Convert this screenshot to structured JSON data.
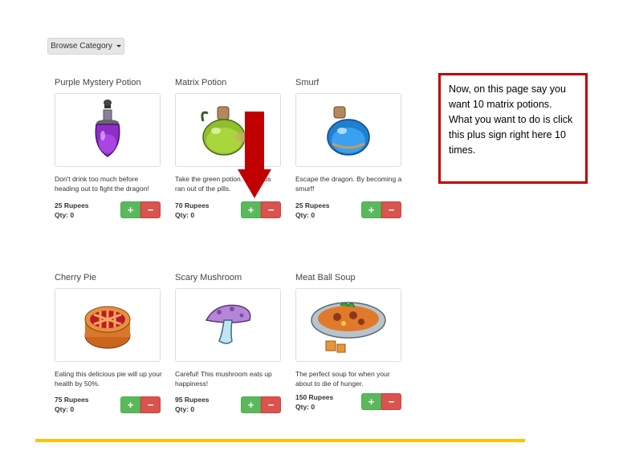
{
  "toolbar": {
    "browse_label": "Browse Category"
  },
  "products": [
    {
      "name": "Purple Mystery Potion",
      "desc": "Don't drink too much before heading out to fight the dragon!",
      "price": "25 Rupees",
      "qty": "Qty: 0",
      "icon": "purple-potion-icon"
    },
    {
      "name": "Matrix Potion",
      "desc": "Take the green potion. Your bus ran out of the pills.",
      "price": "70 Rupees",
      "qty": "Qty: 0",
      "icon": "green-potion-icon"
    },
    {
      "name": "Smurf",
      "desc": "Escape the dragon. By becoming a smurf!",
      "price": "25 Rupees",
      "qty": "Qty: 0",
      "icon": "blue-potion-icon"
    },
    {
      "name": "Cherry Pie",
      "desc": "Eating this delicious pie will up your health by 50%.",
      "price": "75 Rupees",
      "qty": "Qty: 0",
      "icon": "cherry-pie-icon"
    },
    {
      "name": "Scary Mushroom",
      "desc": "Careful! This mushroom eats up happiness!",
      "price": "95 Rupees",
      "qty": "Qty: 0",
      "icon": "mushroom-icon"
    },
    {
      "name": "Meat Ball Soup",
      "desc": "The perfect soup for when your about to die of hunger.",
      "price": "150 Rupees",
      "qty": "Qty: 0",
      "icon": "soup-icon"
    }
  ],
  "buttons": {
    "plus": "+",
    "minus": "−"
  },
  "callout": {
    "text": "Now, on this page say you want 10 matrix potions. What you want to do is click this plus sign right here 10 times."
  },
  "colors": {
    "plus": "#5cb85c",
    "minus": "#d9534f",
    "callout_border": "#c00000",
    "arrow": "#c00000",
    "footer_line": "#ffc000"
  }
}
